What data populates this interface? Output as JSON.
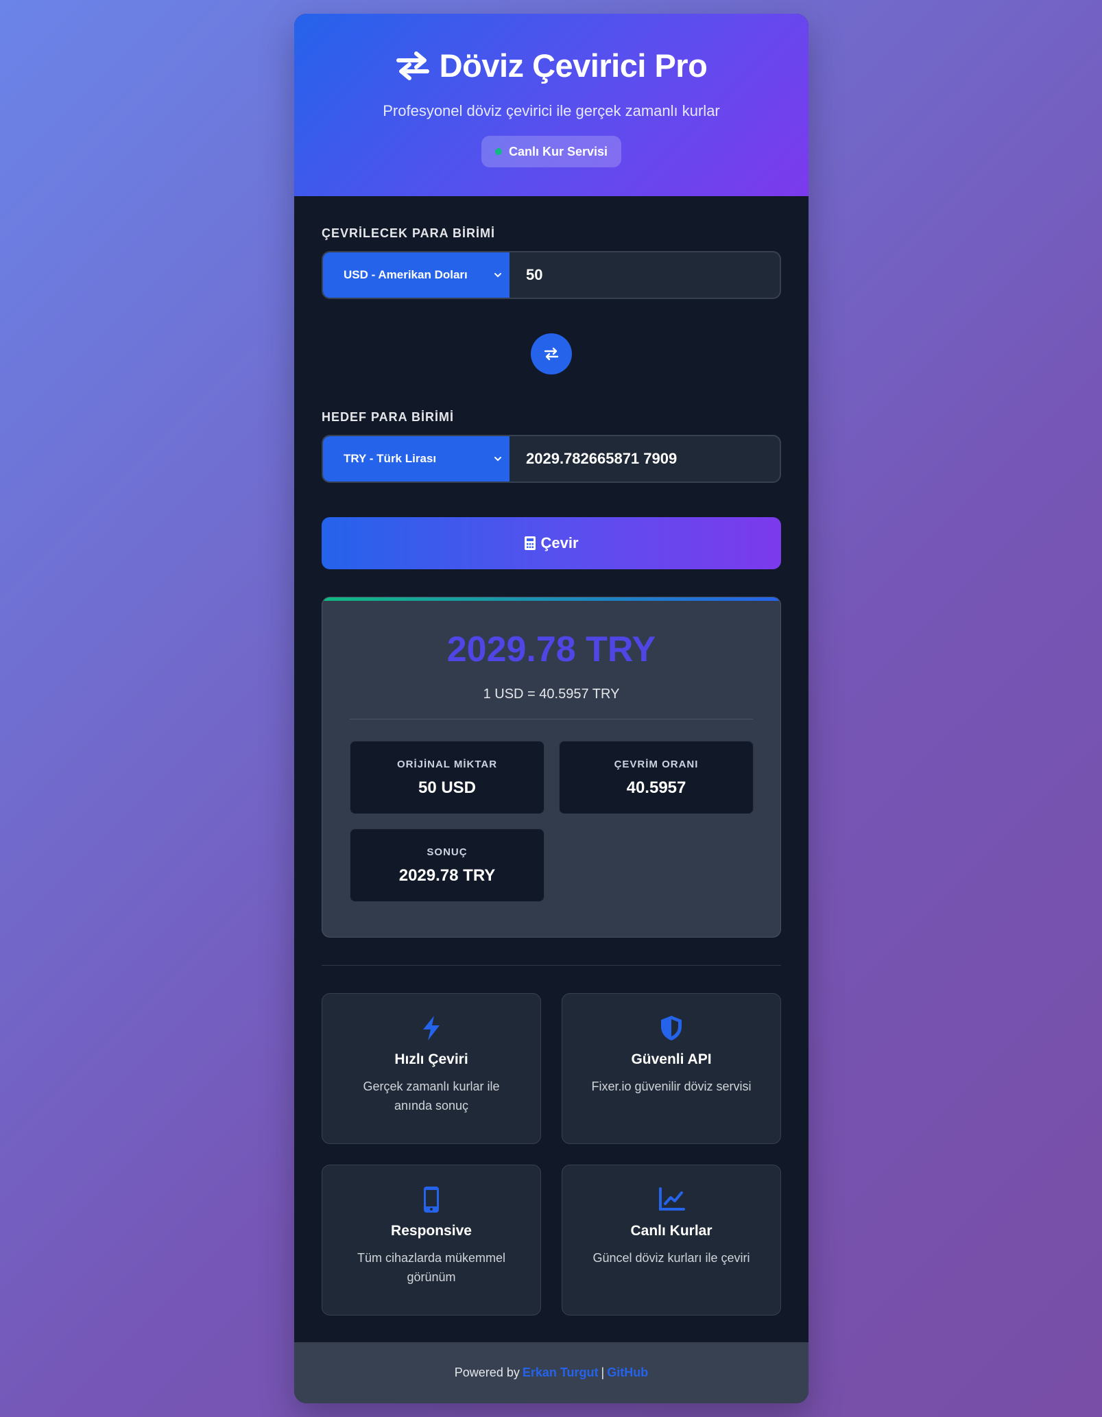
{
  "header": {
    "title": "Döviz Çevirici Pro",
    "subtitle": "Profesyonel döviz çevirici ile gerçek zamanlı kurlar",
    "badge": "Canlı Kur Servisi"
  },
  "from": {
    "label": "ÇEVRİLECEK PARA BİRİMİ",
    "currency": "USD - Amerikan Doları",
    "amount": "50"
  },
  "to": {
    "label": "HEDEF PARA BİRİMİ",
    "currency": "TRY - Türk Lirası",
    "amount": "2029.782665871 7909"
  },
  "convert_button": "Çevir",
  "result": {
    "amount": "2029.78 TRY",
    "rate_line": "1 USD = 40.5957 TRY",
    "stats": [
      {
        "label": "ORİJİNAL MİKTAR",
        "value": "50 USD"
      },
      {
        "label": "ÇEVRİM ORANI",
        "value": "40.5957"
      },
      {
        "label": "SONUÇ",
        "value": "2029.78 TRY"
      }
    ]
  },
  "features": [
    {
      "icon": "bolt-icon",
      "title": "Hızlı Çeviri",
      "desc": "Gerçek zamanlı kurlar ile anında sonuç"
    },
    {
      "icon": "shield-icon",
      "title": "Güvenli API",
      "desc": "Fixer.io güvenilir döviz servisi"
    },
    {
      "icon": "mobile-icon",
      "title": "Responsive",
      "desc": "Tüm cihazlarda mükemmel görünüm"
    },
    {
      "icon": "chart-line-icon",
      "title": "Canlı Kurlar",
      "desc": "Güncel döviz kurları ile çeviri"
    }
  ],
  "footer": {
    "prefix": "Powered by",
    "author": "Erkan Turgut",
    "separator": "|",
    "github": "GitHub"
  },
  "colors": {
    "accent": "#2563eb",
    "purple": "#7c3aed",
    "result_amount": "#4f46e5",
    "live_dot": "#10b981",
    "card_bg": "#111827"
  }
}
